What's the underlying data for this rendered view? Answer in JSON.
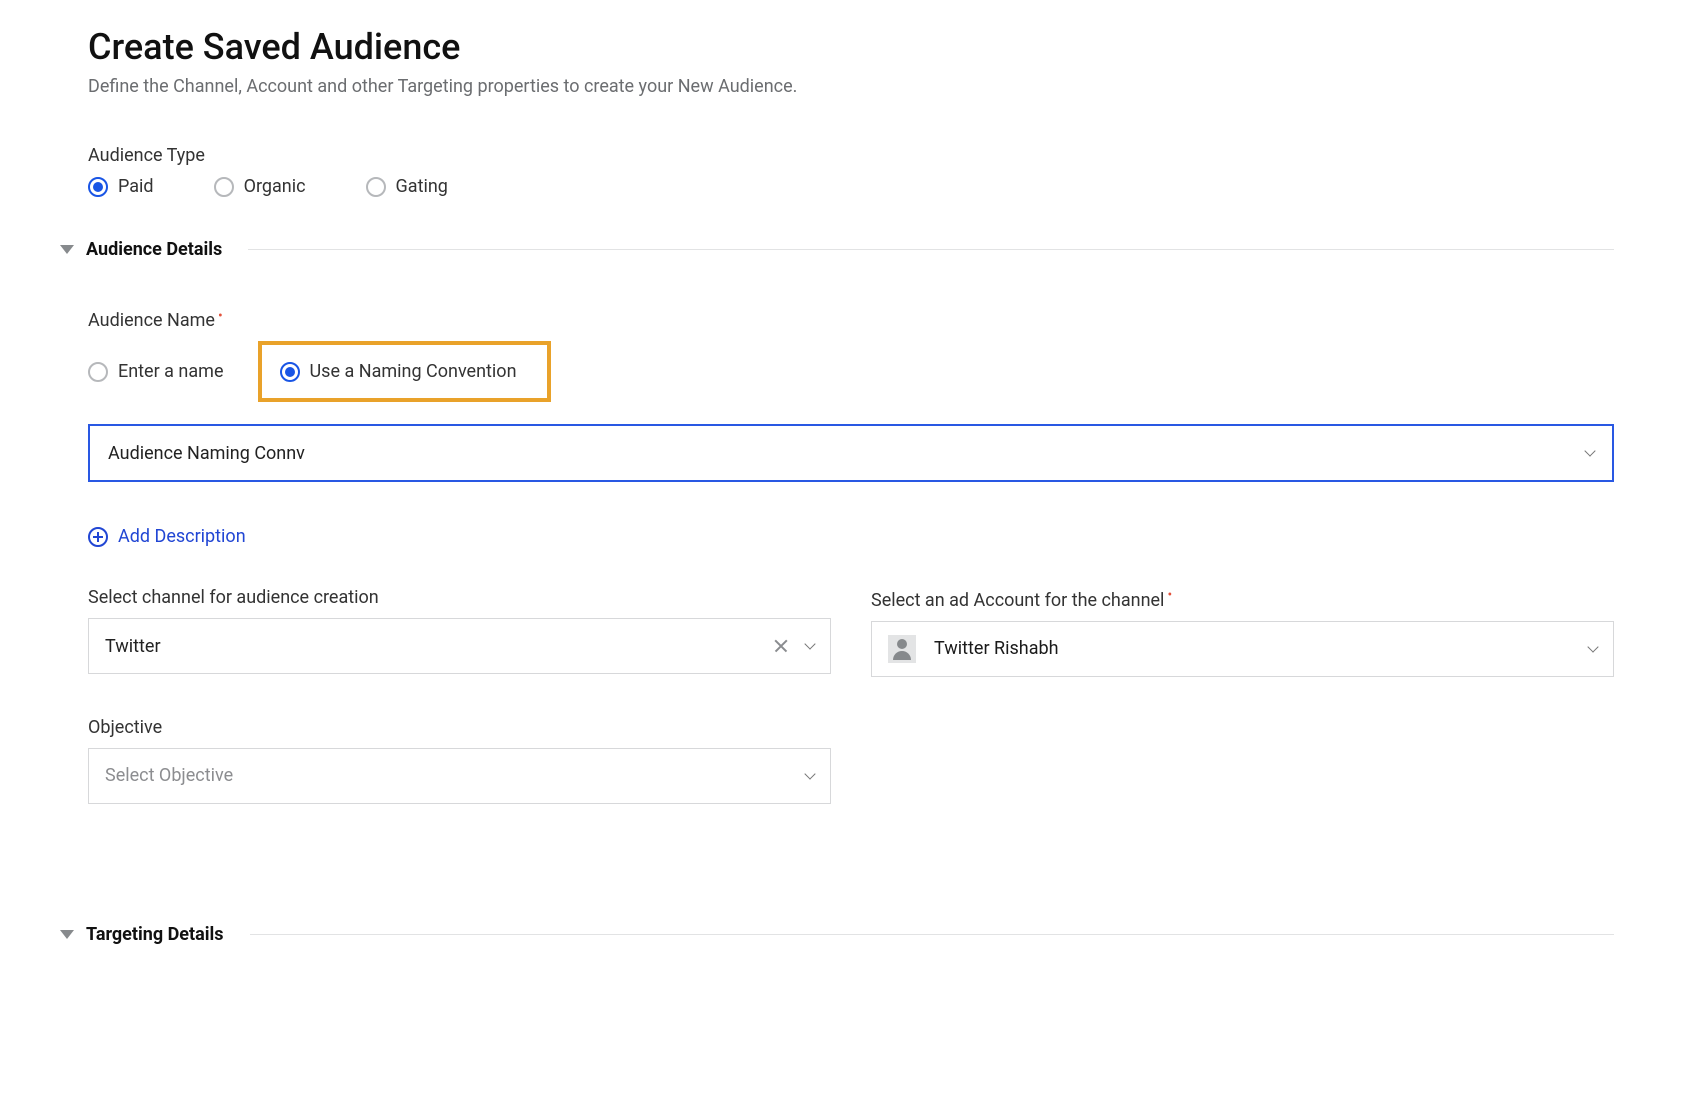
{
  "header": {
    "title": "Create Saved Audience",
    "subtitle": "Define the Channel, Account and other Targeting properties to create your New Audience."
  },
  "audience_type": {
    "label": "Audience Type",
    "options": [
      {
        "label": "Paid",
        "selected": true
      },
      {
        "label": "Organic",
        "selected": false
      },
      {
        "label": "Gating",
        "selected": false
      }
    ]
  },
  "sections": {
    "audience_details": "Audience Details",
    "targeting_details": "Targeting Details"
  },
  "audience_name": {
    "label": "Audience Name",
    "required": true,
    "options": [
      {
        "label": "Enter a name",
        "selected": false
      },
      {
        "label": "Use a Naming Convention",
        "selected": true
      }
    ],
    "naming_select_value": "Audience Naming Connv"
  },
  "add_description_label": "Add Description",
  "channel": {
    "label": "Select channel for audience creation",
    "value": "Twitter"
  },
  "ad_account": {
    "label": "Select an ad Account for the channel",
    "required": true,
    "value": "Twitter Rishabh"
  },
  "objective": {
    "label": "Objective",
    "placeholder": "Select Objective"
  },
  "colors": {
    "accent_blue": "#1955e5",
    "highlight_orange": "#e9a22a",
    "required_red": "#e2523c"
  }
}
